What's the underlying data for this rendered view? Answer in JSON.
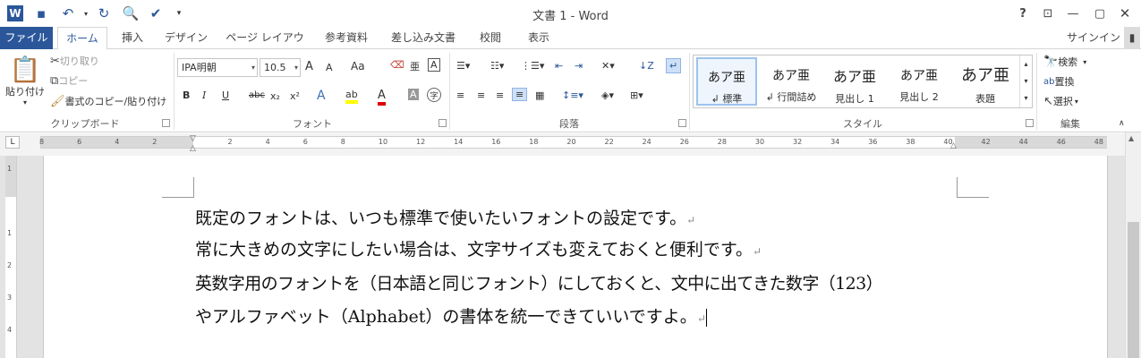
{
  "titlebar": {
    "title": "文書 1 - Word",
    "icons": [
      "word-app-icon",
      "save-icon",
      "undo-icon",
      "redo-icon",
      "print-preview-icon",
      "spelling-check-icon",
      "customize-qat-icon"
    ],
    "help": "?",
    "buttons": [
      "ribbon-display-icon",
      "minimize-icon",
      "restore-icon",
      "close-icon"
    ]
  },
  "tabs": [
    "ファイル",
    "ホーム",
    "挿入",
    "デザイン",
    "ページ レイアウト",
    "参考資料",
    "差し込み文書",
    "校閲",
    "表示"
  ],
  "signin": "サインイン",
  "clipboard": {
    "paste": "貼り付け",
    "cut": "切り取り",
    "copy": "コピー",
    "format_painter": "書式のコピー/貼り付け",
    "label": "クリップボード"
  },
  "font": {
    "name": "IPA明朝",
    "size": "10.5",
    "grow": "A",
    "shrink": "A",
    "case": "Aa",
    "label": "フォント",
    "bold": "B",
    "italic": "I",
    "underline": "U",
    "strike": "abc",
    "sub": "x₂",
    "sup": "x²",
    "effects": "A",
    "highlight": "ab",
    "color": "A",
    "shade": "A",
    "enclose": "字"
  },
  "paragraph": {
    "label": "段落"
  },
  "styles": {
    "label": "スタイル",
    "items": [
      {
        "preview": "あア亜",
        "name": "標準"
      },
      {
        "preview": "あア亜",
        "name": "行間詰め"
      },
      {
        "preview": "あア亜",
        "name": "見出し 1"
      },
      {
        "preview": "あア亜",
        "name": "見出し 2"
      },
      {
        "preview": "あア亜",
        "name": "表題"
      }
    ]
  },
  "editing": {
    "label": "編集",
    "find": "検索",
    "replace": "置換",
    "select": "選択"
  },
  "ruler": {
    "numbers": [
      "8",
      "6",
      "4",
      "2",
      "",
      "2",
      "4",
      "6",
      "8",
      "10",
      "12",
      "14",
      "16",
      "18",
      "20",
      "22",
      "24",
      "26",
      "28",
      "30",
      "32",
      "34",
      "36",
      "38",
      "40",
      "42",
      "44",
      "46",
      "48"
    ],
    "vnumbers": [
      "1",
      "",
      "1",
      "2",
      "3",
      "4"
    ],
    "corner": "L"
  },
  "document": {
    "lines": [
      "既定のフォントは、いつも標準で使いたいフォントの設定です。",
      "常に大きめの文字にしたい場合は、文字サイズも変えておくと便利です。",
      "英数字用のフォントを（日本語と同じフォント）にしておくと、文中に出てきた数字（123）",
      "やアルファベット（Alphabet）の書体を統一できていいですよ。"
    ],
    "para_mark": "↵"
  },
  "colors": {
    "accent": "#2b579a",
    "highlight": "#ffff00",
    "font_color": "#e00000"
  }
}
